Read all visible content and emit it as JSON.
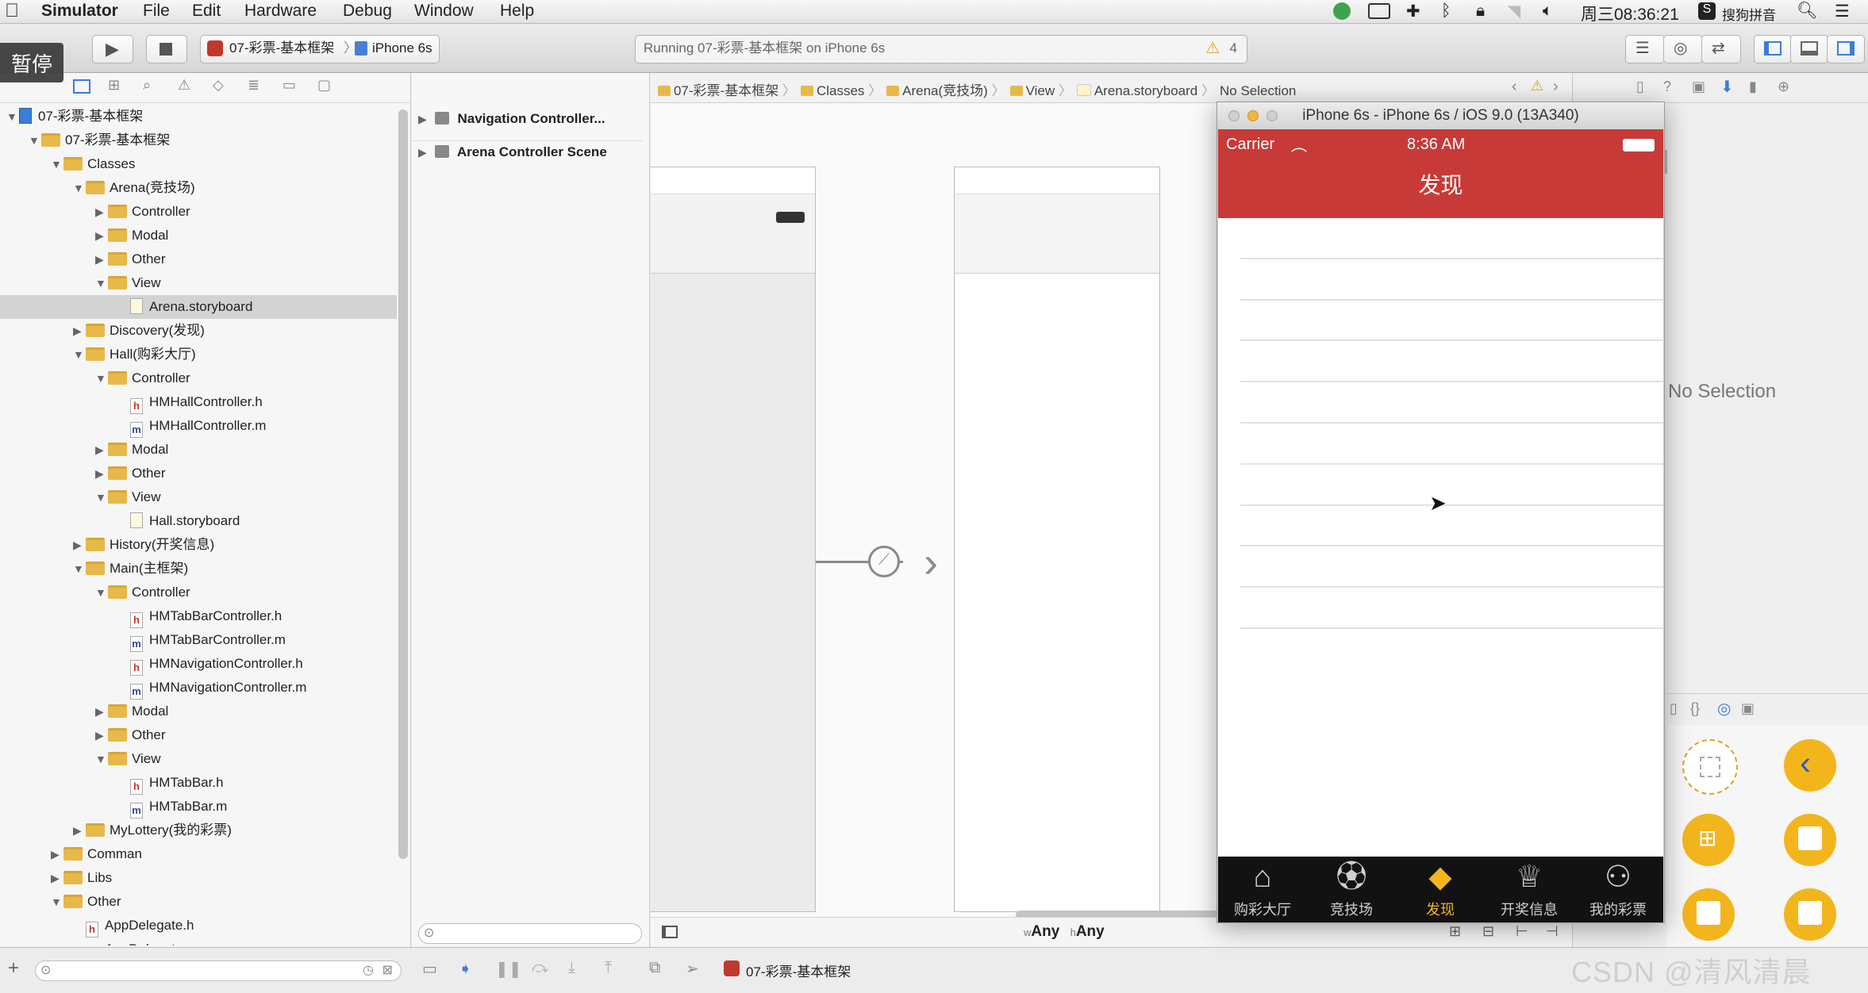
{
  "menubar": {
    "apple": "",
    "app": "Simulator",
    "items": [
      "File",
      "Edit",
      "Hardware",
      "Debug",
      "Window",
      "Help"
    ],
    "clock": "周三08:36:21",
    "ime": "搜狗拼音"
  },
  "toolbar": {
    "pause_badge": "暂停",
    "scheme": "07-彩票-基本框架",
    "device": "iPhone 6s",
    "activity": "Running 07-彩票-基本框架 on iPhone 6s",
    "warning_count": "4"
  },
  "jumpbar": {
    "crumbs": [
      "07-彩票-基本框架",
      "07-彩票-基本框架",
      "Classes",
      "Arena(竞技场)",
      "View",
      "Arena.storyboard",
      "No Selection"
    ]
  },
  "navigator": {
    "rows": [
      {
        "label": "07-彩票-基本框架",
        "indent": 0,
        "kind": "proj",
        "open": true
      },
      {
        "label": "07-彩票-基本框架",
        "indent": 1,
        "kind": "folder",
        "open": true
      },
      {
        "label": "Classes",
        "indent": 2,
        "kind": "folder",
        "open": true
      },
      {
        "label": "Arena(竞技场)",
        "indent": 3,
        "kind": "folder",
        "open": true
      },
      {
        "label": "Controller",
        "indent": 4,
        "kind": "folder",
        "open": false
      },
      {
        "label": "Modal",
        "indent": 4,
        "kind": "folder",
        "open": false
      },
      {
        "label": "Other",
        "indent": 4,
        "kind": "folder",
        "open": false
      },
      {
        "label": "View",
        "indent": 4,
        "kind": "folder",
        "open": true
      },
      {
        "label": "Arena.storyboard",
        "indent": 5,
        "kind": "sb",
        "selected": true
      },
      {
        "label": "Discovery(发现)",
        "indent": 3,
        "kind": "folder",
        "open": false
      },
      {
        "label": "Hall(购彩大厅)",
        "indent": 3,
        "kind": "folder",
        "open": true
      },
      {
        "label": "Controller",
        "indent": 4,
        "kind": "folder",
        "open": true
      },
      {
        "label": "HMHallController.h",
        "indent": 5,
        "kind": "h"
      },
      {
        "label": "HMHallController.m",
        "indent": 5,
        "kind": "m"
      },
      {
        "label": "Modal",
        "indent": 4,
        "kind": "folder",
        "open": false
      },
      {
        "label": "Other",
        "indent": 4,
        "kind": "folder",
        "open": false
      },
      {
        "label": "View",
        "indent": 4,
        "kind": "folder",
        "open": true
      },
      {
        "label": "Hall.storyboard",
        "indent": 5,
        "kind": "sb"
      },
      {
        "label": "History(开奖信息)",
        "indent": 3,
        "kind": "folder",
        "open": false
      },
      {
        "label": "Main(主框架)",
        "indent": 3,
        "kind": "folder",
        "open": true
      },
      {
        "label": "Controller",
        "indent": 4,
        "kind": "folder",
        "open": true
      },
      {
        "label": "HMTabBarController.h",
        "indent": 5,
        "kind": "h"
      },
      {
        "label": "HMTabBarController.m",
        "indent": 5,
        "kind": "m"
      },
      {
        "label": "HMNavigationController.h",
        "indent": 5,
        "kind": "h"
      },
      {
        "label": "HMNavigationController.m",
        "indent": 5,
        "kind": "m"
      },
      {
        "label": "Modal",
        "indent": 4,
        "kind": "folder",
        "open": false
      },
      {
        "label": "Other",
        "indent": 4,
        "kind": "folder",
        "open": false
      },
      {
        "label": "View",
        "indent": 4,
        "kind": "folder",
        "open": true
      },
      {
        "label": "HMTabBar.h",
        "indent": 5,
        "kind": "h"
      },
      {
        "label": "HMTabBar.m",
        "indent": 5,
        "kind": "m"
      },
      {
        "label": "MyLottery(我的彩票)",
        "indent": 3,
        "kind": "folder",
        "open": false
      },
      {
        "label": "Comman",
        "indent": 2,
        "kind": "folder",
        "open": false
      },
      {
        "label": "Libs",
        "indent": 2,
        "kind": "folder",
        "open": false
      },
      {
        "label": "Other",
        "indent": 2,
        "kind": "folder",
        "open": true
      },
      {
        "label": "AppDelegate.h",
        "indent": 3,
        "kind": "h"
      },
      {
        "label": "AppDelegate.m",
        "indent": 3,
        "kind": "m"
      }
    ]
  },
  "outline": {
    "scenes": [
      "Navigation Controller...",
      "Arena Controller Scene"
    ]
  },
  "canvas": {
    "size_class_w": "w",
    "size_class_w_val": "Any",
    "size_class_h": "h",
    "size_class_h_val": "Any"
  },
  "inspector": {
    "no_selection": "No Selection"
  },
  "simulator": {
    "title": "iPhone 6s - iPhone 6s / iOS 9.0 (13A340)",
    "carrier": "Carrier",
    "time": "8:36 AM",
    "nav_title": "发现",
    "tabs": [
      {
        "label": "购彩大厅",
        "icon": "house-icon"
      },
      {
        "label": "竞技场",
        "icon": "soccer-ball-icon"
      },
      {
        "label": "发现",
        "icon": "diamond-icon",
        "active": true
      },
      {
        "label": "开奖信息",
        "icon": "trophy-icon"
      },
      {
        "label": "我的彩票",
        "icon": "person-icon"
      }
    ],
    "colors": {
      "nav": "#c83a38",
      "tabbar": "#121212",
      "active": "#f3b51c"
    }
  },
  "bottombar": {
    "scheme_label": "07-彩票-基本框架"
  },
  "watermark": "CSDN @清风清晨"
}
